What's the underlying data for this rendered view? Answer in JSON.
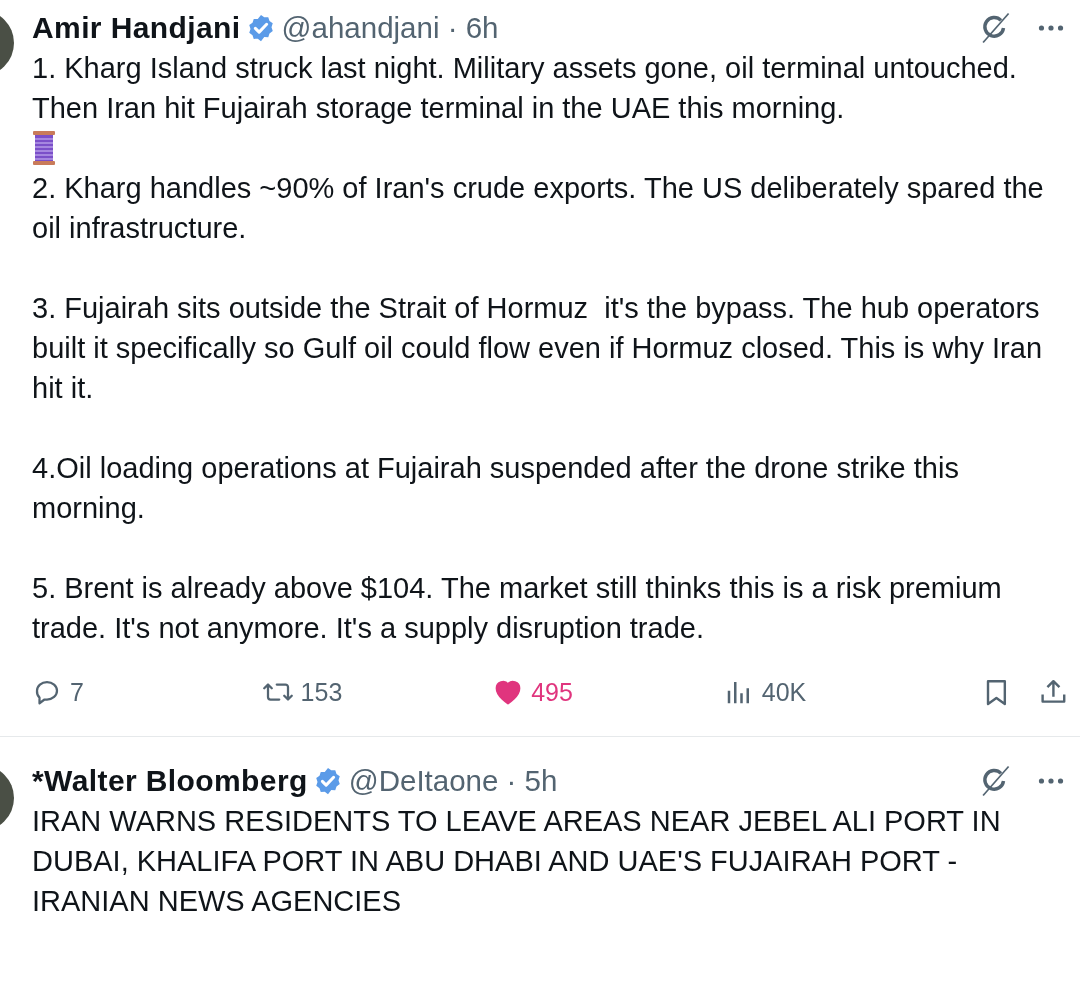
{
  "tweets": [
    {
      "author": "Amir Handjani",
      "verified": true,
      "handle": "@ahandjani",
      "separator": "·",
      "time": "6h",
      "blocks": [
        {
          "kind": "text",
          "text": "1. Kharg Island struck last night. Military assets gone, oil terminal untouched.\nThen Iran hit Fujairah storage terminal in the UAE this morning."
        },
        {
          "kind": "thread"
        },
        {
          "kind": "text",
          "text": "2. Kharg handles ~90% of Iran's crude exports. The US deliberately spared the oil infrastructure."
        },
        {
          "kind": "text",
          "text": "3. Fujairah sits outside the Strait of Hormuz  it's the bypass. The hub operators built it specifically so Gulf oil could flow even if Hormuz closed. This is why Iran hit it."
        },
        {
          "kind": "text",
          "text": "4.Oil loading operations at Fujairah suspended after the drone strike this morning."
        },
        {
          "kind": "text",
          "text": "5. Brent is already above $104. The market still thinks this is a risk premium trade. It's not anymore. It's a supply disruption trade."
        }
      ],
      "actions": {
        "replies": "7",
        "reposts": "153",
        "likes": "495",
        "liked": true,
        "views": "40K"
      }
    },
    {
      "author": "*Walter Bloomberg",
      "verified": true,
      "handle": "@DeItaone",
      "separator": "·",
      "time": "5h",
      "blocks": [
        {
          "kind": "text",
          "text": "IRAN WARNS RESIDENTS TO LEAVE AREAS NEAR JEBEL ALI PORT IN DUBAI, KHALIFA PORT IN ABU DHABI AND UAE'S FUJAIRAH PORT - IRANIAN NEWS AGENCIES"
        }
      ]
    }
  ]
}
